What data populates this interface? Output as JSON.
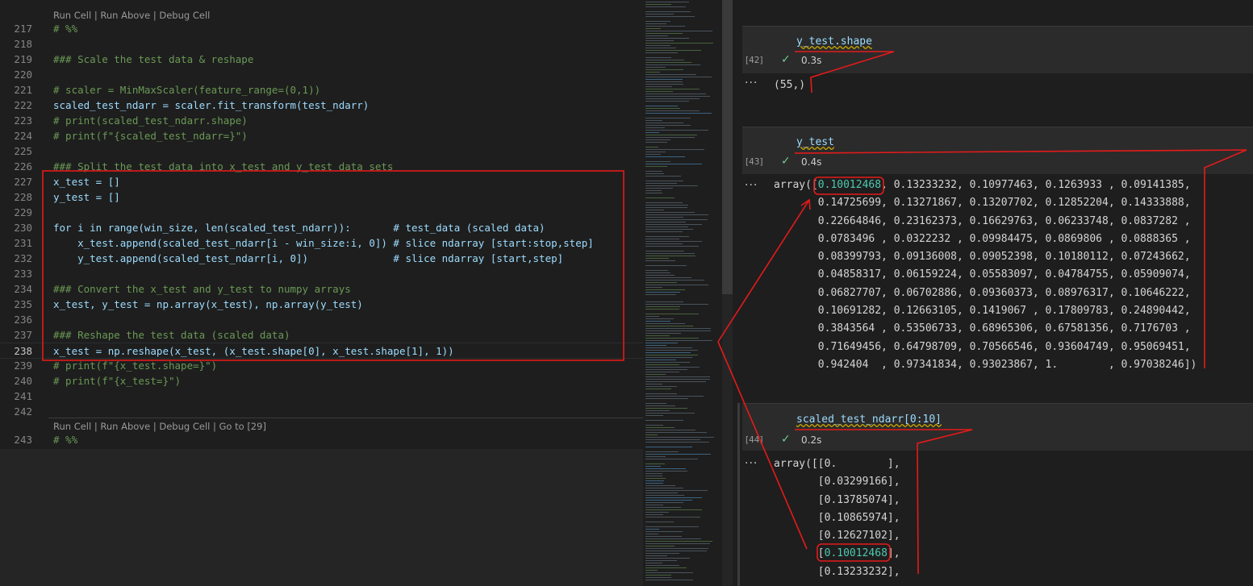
{
  "editor": {
    "code_lens": {
      "top": "Run Cell | Run Above | Debug Cell",
      "bottom": "Run Cell | Run Above | Debug Cell | Go to [29]"
    },
    "lines": [
      {
        "num": "217",
        "text": "# %%"
      },
      {
        "num": "218",
        "text": ""
      },
      {
        "num": "219",
        "text": "### Scale the test data & reshape"
      },
      {
        "num": "220",
        "text": ""
      },
      {
        "num": "221",
        "text": "# scaler = MinMaxScaler(feature_range=(0,1))"
      },
      {
        "num": "222",
        "text": "scaled_test_ndarr = scaler.fit_transform(test_ndarr)"
      },
      {
        "num": "223",
        "text": "# print(scaled_test_ndarr.shape)"
      },
      {
        "num": "224",
        "text": "# print(f\"{scaled_test_ndarr=}\")"
      },
      {
        "num": "225",
        "text": ""
      },
      {
        "num": "226",
        "text": "### Split the test data into x_test and y_test data sets"
      },
      {
        "num": "227",
        "text": "x_test = []"
      },
      {
        "num": "228",
        "text": "y_test = []"
      },
      {
        "num": "229",
        "text": ""
      },
      {
        "num": "230",
        "text": "for i in range(win_size, len(scaled_test_ndarr)):       # test_data (scaled data)"
      },
      {
        "num": "231",
        "text": "    x_test.append(scaled_test_ndarr[i - win_size:i, 0]) # slice ndarray [start:stop,step]"
      },
      {
        "num": "232",
        "text": "    y_test.append(scaled_test_ndarr[i, 0])              # slice ndarray [start,step]"
      },
      {
        "num": "233",
        "text": ""
      },
      {
        "num": "234",
        "text": "### Convert the x_test and y_test to numpy arrays"
      },
      {
        "num": "235",
        "text": "x_test, y_test = np.array(x_test), np.array(y_test)"
      },
      {
        "num": "236",
        "text": ""
      },
      {
        "num": "237",
        "text": "### Reshape the test data (scaled data)"
      },
      {
        "num": "238",
        "text": "x_test = np.reshape(x_test, (x_test.shape[0], x_test.shape[1], 1))"
      },
      {
        "num": "239",
        "text": "# print(f\"{x_test.shape=}\")"
      },
      {
        "num": "240",
        "text": "# print(f\"{x_test=}\")"
      },
      {
        "num": "241",
        "text": ""
      },
      {
        "num": "242",
        "text": ""
      },
      {
        "num": "243",
        "text": "# %%"
      }
    ]
  },
  "notebook": {
    "cells": [
      {
        "count": "[42]",
        "code": "y_test.shape",
        "duration": "0.3s",
        "output": [
          "(55,)"
        ]
      },
      {
        "count": "[43]",
        "code": "y_test",
        "duration": "0.4s",
        "output": [
          "array([0.10012468, 0.13233232, 0.10977463, 0.1263933 , 0.09141385,",
          "       0.14725699, 0.13271867, 0.13207702, 0.12852204, 0.14333888,",
          "       0.22664846, 0.23162373, 0.16629763, 0.06233748, 0.0837282 ,",
          "       0.0783496 , 0.0322232 , 0.09984475, 0.0869806 , 0.0888365 ,",
          "       0.08399793, 0.09136008, 0.09052398, 0.10180112, 0.07243662,",
          "       0.04858317, 0.06159224, 0.05583097, 0.04784755, 0.05909074,",
          "       0.06827707, 0.06702886, 0.09360373, 0.08976317, 0.10646222,",
          "       0.10691282, 0.12663105, 0.1419067 , 0.17809783, 0.24890442,",
          "       0.3843564 , 0.53506733, 0.68965306, 0.67581356, 0.7176703 ,",
          "       0.71649456, 0.64798709, 0.70566546, 0.93604749, 0.95069451,",
          "       0.942404  , 0.97341834, 0.93023867, 1.        , 0.97038246])"
        ]
      },
      {
        "count": "[44]",
        "code": "scaled_test_ndarr[0:10]",
        "duration": "0.2s",
        "output": [
          "array([[0.        ],",
          "       [0.03299166],",
          "       [0.13785074],",
          "       [0.10865974],",
          "       [0.12627102],",
          "       [0.10012468],",
          "       [0.13233232],"
        ]
      }
    ],
    "more_icon": "ellipsis-icon",
    "success_icon": "check-icon"
  },
  "colors": {
    "annotation": "#e51a1a",
    "editor_bg": "#1e1e1e",
    "cell_bg": "#2b2b2b",
    "highlight_value": "#4ec9b0"
  }
}
